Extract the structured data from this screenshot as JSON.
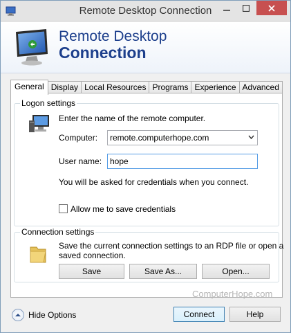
{
  "window": {
    "title": "Remote Desktop Connection",
    "controls": {
      "minimize": "minimize",
      "maximize": "maximize",
      "close": "close"
    }
  },
  "banner": {
    "line1": "Remote Desktop",
    "line2": "Connection"
  },
  "tabs": [
    {
      "label": "General",
      "active": true
    },
    {
      "label": "Display",
      "active": false
    },
    {
      "label": "Local Resources",
      "active": false
    },
    {
      "label": "Programs",
      "active": false
    },
    {
      "label": "Experience",
      "active": false
    },
    {
      "label": "Advanced",
      "active": false
    }
  ],
  "logon": {
    "legend": "Logon settings",
    "instructions": "Enter the name of the remote computer.",
    "computer_label": "Computer:",
    "computer_value": "remote.computerhope.com",
    "username_label": "User name:",
    "username_value": "hope",
    "credentials_note": "You will be asked for credentials when you connect.",
    "save_credentials_label": "Allow me to save credentials",
    "save_credentials_checked": false
  },
  "connection": {
    "legend": "Connection settings",
    "description_line1": "Save the current connection settings to an RDP file or open a",
    "description_line2": "saved connection.",
    "save_label": "Save",
    "save_as_label": "Save As...",
    "open_label": "Open..."
  },
  "watermark": "ComputerHope.com",
  "footer": {
    "hide_options_label": "Hide Options",
    "connect_label": "Connect",
    "help_label": "Help"
  },
  "colors": {
    "banner_text": "#1d3f8c",
    "close_button": "#c75050",
    "default_button_border": "#3c7fb1"
  }
}
